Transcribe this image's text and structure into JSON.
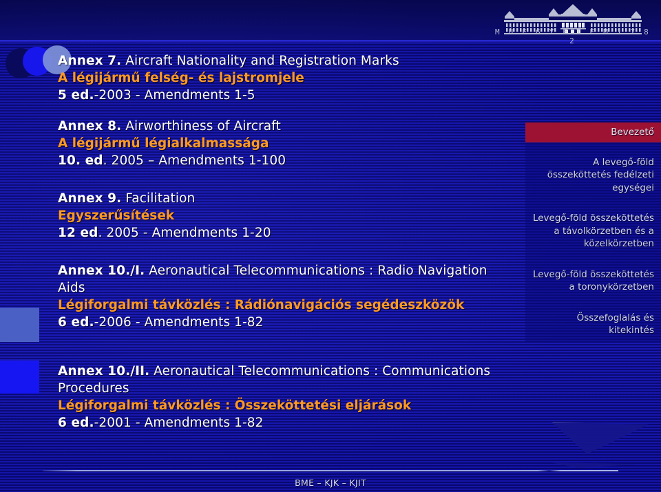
{
  "header": {
    "logo_name": "bme-muegyetem-logo",
    "logo_wordmark": "M Ú E G Y E T E M   1 7 8 2"
  },
  "content": {
    "blocks": [
      {
        "en_bold": "Annex 7.",
        "en_rest": " Aircraft Nationality and Registration Marks",
        "hu": "A légijármű felség- és lajstromjele",
        "ed_bold": "5 ed.",
        "ed_rest": "-2003 - Amendments 1-5"
      },
      {
        "en_bold": "Annex 8.",
        "en_rest": " Airworthiness of Aircraft",
        "hu": "A légijármű légialkalmassága",
        "ed_bold": "10. ed",
        "ed_rest": ". 2005 – Amendments 1-100"
      },
      {
        "en_bold": "Annex 9.",
        "en_rest": " Facilitation",
        "hu": "Egyszerűsítések",
        "ed_bold": "12 ed",
        "ed_rest": ". 2005 - Amendments 1-20"
      },
      {
        "en_bold": "Annex 10./I.",
        "en_rest": " Aeronautical Telecommunications : Radio Navigation Aids",
        "hu": "Légiforgalmi távközlés : Rádiónavigációs segédeszközök",
        "ed_bold": "6 ed.",
        "ed_rest": "-2006 - Amendments 1-82"
      },
      {
        "en_bold": "Annex 10./II.",
        "en_rest": " Aeronautical Telecommunications : Communications Procedures",
        "hu": "Légiforgalmi távközlés : Összeköttetési eljárások",
        "ed_bold": "6 ed.",
        "ed_rest": "-2001 - Amendments 1-82"
      }
    ]
  },
  "sidebar": {
    "items": [
      {
        "label": "Bevezető",
        "active": true
      },
      {
        "label": "A levegő-föld összeköttetés fedélzeti egységei",
        "active": false
      },
      {
        "label": "Levegő-föld összeköttetés a távolkörzetben és a közelkörzetben",
        "active": false
      },
      {
        "label": "Levegő-föld összeköttetés a toronykörzetben",
        "active": false
      },
      {
        "label": "Összefoglalás és kitekintés",
        "active": false
      }
    ],
    "active_color": "#9d1233"
  },
  "footer": {
    "text": "BME – KJK – KJIT"
  },
  "colors": {
    "background_blue": "#1414a6",
    "header_navy": "#0a0a63",
    "accent_orange": "#ff9922",
    "accent_crimson": "#9d1233",
    "text_white": "#ffffff"
  }
}
